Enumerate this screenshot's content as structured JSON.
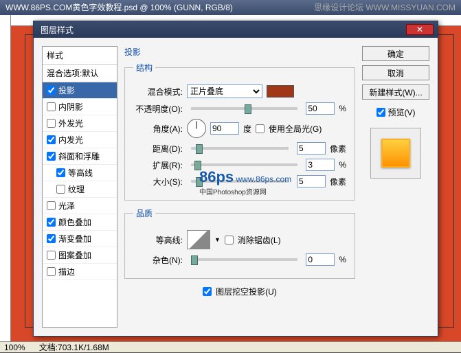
{
  "app": {
    "title_left": "WWW.86PS.COM黄色字效教程.psd @ 100% (GUNN, RGB/8)",
    "title_right": "思缘设计论坛  WWW.MISSYUAN.COM"
  },
  "status": {
    "zoom": "100%",
    "doc": "文档:703.1K/1.68M"
  },
  "dialog": {
    "title": "图层样式",
    "close_glyph": "✕",
    "styles": {
      "header": "样式",
      "blend_default": "混合选项:默认",
      "items": [
        {
          "label": "投影",
          "checked": true,
          "selected": true
        },
        {
          "label": "内阴影",
          "checked": false
        },
        {
          "label": "外发光",
          "checked": false
        },
        {
          "label": "内发光",
          "checked": true
        },
        {
          "label": "斜面和浮雕",
          "checked": true
        },
        {
          "label": "等高线",
          "checked": true,
          "indent": true
        },
        {
          "label": "纹理",
          "checked": false,
          "indent": true
        },
        {
          "label": "光泽",
          "checked": false
        },
        {
          "label": "颜色叠加",
          "checked": true
        },
        {
          "label": "渐变叠加",
          "checked": true
        },
        {
          "label": "图案叠加",
          "checked": false
        },
        {
          "label": "描边",
          "checked": false
        }
      ]
    },
    "shadow": {
      "section": "投影",
      "struct_legend": "结构",
      "blend_mode_label": "混合模式:",
      "blend_mode_value": "正片叠底",
      "opacity_label": "不透明度(O):",
      "opacity_value": "50",
      "opacity_unit": "%",
      "angle_label": "角度(A):",
      "angle_value": "90",
      "angle_unit": "度",
      "global_light_label": "使用全局光(G)",
      "global_light_checked": false,
      "distance_label": "距离(D):",
      "distance_value": "5",
      "distance_unit": "像素",
      "spread_label": "扩展(R):",
      "spread_value": "3",
      "spread_unit": "%",
      "size_label": "大小(S):",
      "size_value": "5",
      "size_unit": "像素",
      "quality_legend": "品质",
      "contour_label": "等高线:",
      "antialias_label": "消除锯齿(L)",
      "antialias_checked": false,
      "noise_label": "杂色(N):",
      "noise_value": "0",
      "noise_unit": "%",
      "knockout_label": "图层挖空投影(U)",
      "knockout_checked": true
    },
    "buttons": {
      "ok": "确定",
      "cancel": "取消",
      "new_style": "新建样式(W)...",
      "preview": "预览(V)",
      "preview_checked": true
    }
  },
  "watermark": {
    "brand": "86ps",
    "url": "www.86ps.com",
    "sub": "中国Photoshop资源网"
  }
}
